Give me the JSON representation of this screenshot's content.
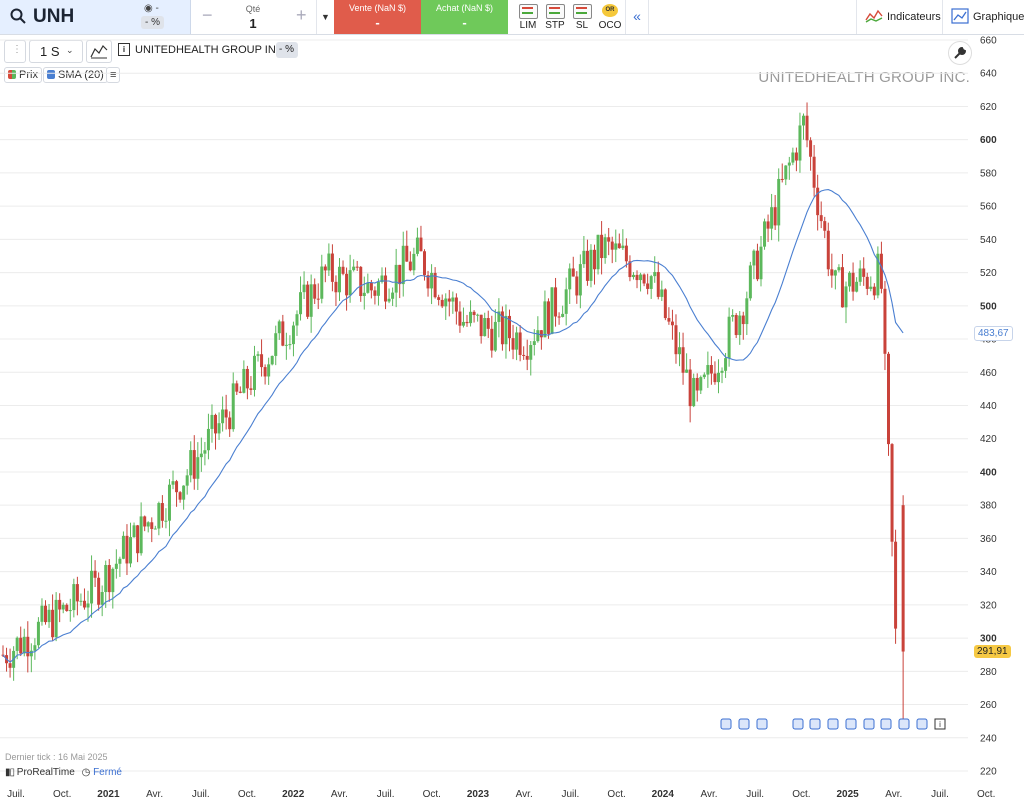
{
  "header": {
    "symbol": "UNH",
    "change_label": "-",
    "change_pct": "- %",
    "qty_label": "Qté",
    "qty_value": "1",
    "sell_label": "Vente (NaN $)",
    "sell_value": "-",
    "buy_label": "Achat (NaN $)",
    "buy_value": "-",
    "orders": [
      "LIM",
      "STP",
      "SL",
      "OCO"
    ],
    "oco_badge": "OR",
    "indicators_label": "Indicateurs",
    "chart_label": "Graphique"
  },
  "toolbar": {
    "interval": "1 S",
    "instrument": "UNITEDHEALTH GROUP INC.",
    "pct": "- %"
  },
  "legend": {
    "price": "Prix",
    "sma": "SMA (20)",
    "price_color": "#5cb85c",
    "sma_color": "#4a7fd1"
  },
  "watermark": "UNITEDHEALTH GROUP INC.",
  "price_labels": {
    "sma_value": "483,67",
    "last_price": "291,91"
  },
  "footer": {
    "last_tick": "Dernier tick : 16 Mai 2025",
    "brand": "ProRealTime",
    "status": "Fermé"
  },
  "chart_data": {
    "type": "candlestick",
    "y_axis": {
      "min": 220,
      "max": 660,
      "step": 20,
      "side": "right"
    },
    "x_ticks": [
      "Juil.",
      "Oct.",
      "2021",
      "Avr.",
      "Juil.",
      "Oct.",
      "2022",
      "Avr.",
      "Juil.",
      "Oct.",
      "2023",
      "Avr.",
      "Juil.",
      "Oct.",
      "2024",
      "Avr.",
      "Juil.",
      "Oct.",
      "2025",
      "Avr.",
      "Juil.",
      "Oct."
    ],
    "x_tick_emphasis": [
      "2021",
      "2022",
      "2023",
      "2024",
      "2025"
    ],
    "series": [
      {
        "name": "Prix",
        "kind": "weekly-ohlc"
      },
      {
        "name": "SMA (20)",
        "kind": "moving-average"
      }
    ],
    "key_closes": [
      {
        "date": "2020-07",
        "value": 290
      },
      {
        "date": "2021-01",
        "value": 330
      },
      {
        "date": "2021-07",
        "value": 400
      },
      {
        "date": "2021-11",
        "value": 455
      },
      {
        "date": "2022-04",
        "value": 520
      },
      {
        "date": "2022-07",
        "value": 510
      },
      {
        "date": "2022-10",
        "value": 530
      },
      {
        "date": "2023-01",
        "value": 490
      },
      {
        "date": "2023-05",
        "value": 480
      },
      {
        "date": "2023-10",
        "value": 535
      },
      {
        "date": "2024-01",
        "value": 520
      },
      {
        "date": "2024-04",
        "value": 440
      },
      {
        "date": "2024-07",
        "value": 500
      },
      {
        "date": "2024-11",
        "value": 610
      },
      {
        "date": "2025-01",
        "value": 510
      },
      {
        "date": "2025-04",
        "value": 520
      },
      {
        "date": "2025-05",
        "value": 291.91
      }
    ],
    "last_price": 291.91,
    "sma_last": 483.67,
    "grid": "horizontal",
    "event_markers": 12
  }
}
